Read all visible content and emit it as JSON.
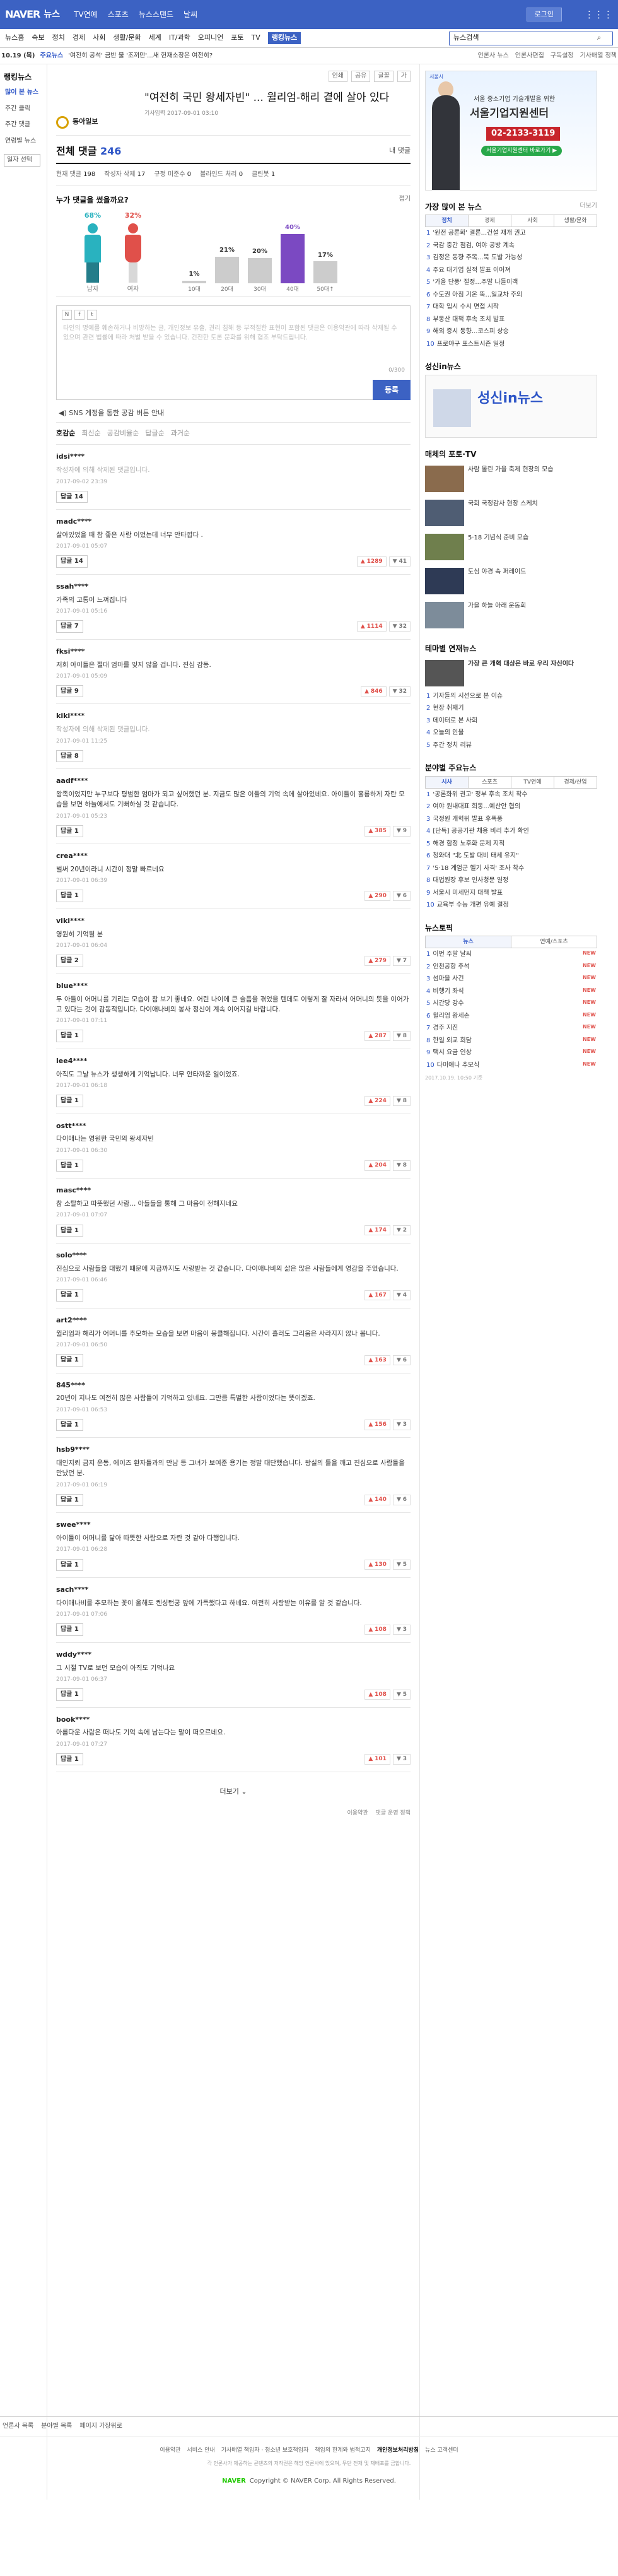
{
  "gnb": {
    "logo": "NAVER",
    "service": "뉴스",
    "tabs": [
      "TV연예",
      "스포츠",
      "뉴스스탠드",
      "날씨"
    ],
    "login": "로그인",
    "grid_icon": "grid-icon"
  },
  "lnb": {
    "items": [
      "뉴스홈",
      "속보",
      "정치",
      "경제",
      "사회",
      "생활/문화",
      "세계",
      "IT/과학",
      "오피니언",
      "포토",
      "TV",
      "랭킹뉴스"
    ],
    "active": 11,
    "search_placeholder": "뉴스검색"
  },
  "ticker": {
    "date": "10.19 (목)",
    "label": "주요뉴스",
    "headline": "'여전히 공석' 금반 불 '조끼만'...새 헌재소장은 여전히?",
    "right": [
      "언론사 뉴스",
      "언론사편집",
      "구독설정",
      "기사배열 정책"
    ]
  },
  "side": {
    "title": "랭킹뉴스",
    "items": [
      "많이 본 뉴스",
      "주간 클릭",
      "주간 댓글",
      "연령별 뉴스"
    ],
    "active": 0,
    "filter": "일자 선택"
  },
  "article": {
    "tools": [
      "인쇄",
      "공유",
      "글꼴",
      "가"
    ],
    "press": "동아일보",
    "headline": "\"여전히 국민 왕세자빈\" ... 윌리엄-해리 곁에 살아 있다",
    "meta": "기사입력 2017-09-01 03:10"
  },
  "comments": {
    "title": "전체 댓글",
    "count": "246",
    "mine": "내 댓글",
    "stats": [
      {
        "k": "현재 댓글",
        "v": "198"
      },
      {
        "k": "작성자 삭제",
        "v": "17"
      },
      {
        "k": "규정 미준수",
        "v": "0"
      },
      {
        "k": "블라인드 처리",
        "v": "0"
      },
      {
        "k": "클린봇",
        "v": "1"
      }
    ],
    "who_title": "누가 댓글을 썼을까요?",
    "fold": "접기",
    "gender": [
      {
        "label": "남자",
        "pct": "68%",
        "color": "#29b2bf"
      },
      {
        "label": "여자",
        "pct": "32%",
        "color": "#e0504a"
      }
    ],
    "ages_chart_label": "연령별",
    "write_placeholder": "타인의 명예를 훼손하거나 비방하는 글, 개인정보 유출, 권리 침해 등 부적절한 표현이 포함된 댓글은 이용약관에 따라 삭제될 수 있으며 관련 법률에 따라 처벌 받을 수 있습니다. 건전한 토론 문화를 위해 협조 부탁드립니다.",
    "counter": "0/300",
    "submit": "등록",
    "sns_notice": "SNS 계정을 통한 공감 버튼 안내",
    "sort": [
      "호감순",
      "최신순",
      "공감비율순",
      "답글순",
      "과거순"
    ],
    "list": [
      {
        "nick": "idsi****",
        "text": "작성자에 의해 삭제된 댓글입니다.",
        "deleted": true,
        "date": "2017-09-02 23:39",
        "reply": "답글 14",
        "up": "",
        "down": ""
      },
      {
        "nick": "madc****",
        "text": "살아있었을 때 참 좋은 사람 이었는데 너무 안타깝다 .",
        "deleted": false,
        "date": "2017-09-01 05:07",
        "reply": "답글 14",
        "up": "1289",
        "down": "41"
      },
      {
        "nick": "ssah****",
        "text": "가족의 고통이 느껴집니다",
        "deleted": false,
        "date": "2017-09-01 05:16",
        "reply": "답글 7",
        "up": "1114",
        "down": "32"
      },
      {
        "nick": "fksi****",
        "text": "저희 아이들은 절대 엄마를 잊지 않을 겁니다. 진심 감동.",
        "deleted": false,
        "date": "2017-09-01 05:09",
        "reply": "답글 9",
        "up": "846",
        "down": "32"
      },
      {
        "nick": "kiki****",
        "text": "작성자에 의해 삭제된 댓글입니다.",
        "deleted": true,
        "date": "2017-09-01 11:25",
        "reply": "답글 8",
        "up": "",
        "down": ""
      },
      {
        "nick": "aadf****",
        "text": "왕족이었지만 누구보다 평범한 엄마가 되고 싶어했던 분. 지금도 많은 이들의 기억 속에 살아있네요. 아이들이 훌륭하게 자란 모습을 보면 하늘에서도 기뻐하실 것 같습니다.",
        "deleted": false,
        "date": "2017-09-01 05:23",
        "reply": "답글 1",
        "up": "385",
        "down": "9"
      },
      {
        "nick": "crea****",
        "text": "벌써 20년이라니 시간이 정말 빠르네요",
        "deleted": false,
        "date": "2017-09-01 06:39",
        "reply": "답글 1",
        "up": "290",
        "down": "6"
      },
      {
        "nick": "viki****",
        "text": "영원히 기억될 분",
        "deleted": false,
        "date": "2017-09-01 06:04",
        "reply": "답글 2",
        "up": "279",
        "down": "7"
      },
      {
        "nick": "blue****",
        "text": "두 아들이 어머니를 기리는 모습이 참 보기 좋네요. 어린 나이에 큰 슬픔을 겪었을 텐데도 이렇게 잘 자라서 어머니의 뜻을 이어가고 있다는 것이 감동적입니다. 다이애나비의 봉사 정신이 계속 이어지길 바랍니다.",
        "deleted": false,
        "date": "2017-09-01 07:11",
        "reply": "답글 1",
        "up": "287",
        "down": "8"
      },
      {
        "nick": "lee4****",
        "text": "아직도 그날 뉴스가 생생하게 기억납니다. 너무 안타까운 일이었죠.",
        "deleted": false,
        "date": "2017-09-01 06:18",
        "reply": "답글 1",
        "up": "224",
        "down": "8"
      },
      {
        "nick": "ostt****",
        "text": "다이애나는 영원한 국민의 왕세자빈",
        "deleted": false,
        "date": "2017-09-01 06:30",
        "reply": "답글 1",
        "up": "204",
        "down": "8"
      },
      {
        "nick": "masc****",
        "text": "참 소탈하고 따뜻했던 사람... 아들들을 통해 그 마음이 전해지네요",
        "deleted": false,
        "date": "2017-09-01 07:07",
        "reply": "답글 1",
        "up": "174",
        "down": "2"
      },
      {
        "nick": "solo****",
        "text": "진심으로 사람들을 대했기 때문에 지금까지도 사랑받는 것 같습니다. 다이애나비의 삶은 많은 사람들에게 영감을 주었습니다.",
        "deleted": false,
        "date": "2017-09-01 06:46",
        "reply": "답글 1",
        "up": "167",
        "down": "4"
      },
      {
        "nick": "art2****",
        "text": "윌리엄과 해리가 어머니를 추모하는 모습을 보면 마음이 뭉클해집니다. 시간이 흘러도 그리움은 사라지지 않나 봅니다.",
        "deleted": false,
        "date": "2017-09-01 06:50",
        "reply": "답글 1",
        "up": "163",
        "down": "6"
      },
      {
        "nick": "845****",
        "text": "20년이 지나도 여전히 많은 사람들이 기억하고 있네요. 그만큼 특별한 사람이었다는 뜻이겠죠.",
        "deleted": false,
        "date": "2017-09-01 06:53",
        "reply": "답글 1",
        "up": "156",
        "down": "3"
      },
      {
        "nick": "hsb9****",
        "text": "대인지뢰 금지 운동, 에이즈 환자들과의 만남 등 그녀가 보여준 용기는 정말 대단했습니다. 왕실의 틀을 깨고 진심으로 사람들을 만났던 분.",
        "deleted": false,
        "date": "2017-09-01 06:19",
        "reply": "답글 1",
        "up": "140",
        "down": "6"
      },
      {
        "nick": "swee****",
        "text": "아이들이 어머니를 닮아 따뜻한 사람으로 자란 것 같아 다행입니다.",
        "deleted": false,
        "date": "2017-09-01 06:28",
        "reply": "답글 1",
        "up": "130",
        "down": "5"
      },
      {
        "nick": "sach****",
        "text": "다이애나비를 추모하는 꽃이 올해도 켄싱턴궁 앞에 가득했다고 하네요. 여전히 사랑받는 이유를 알 것 같습니다.",
        "deleted": false,
        "date": "2017-09-01 07:06",
        "reply": "답글 1",
        "up": "108",
        "down": "3"
      },
      {
        "nick": "wddy****",
        "text": "그 시절 TV로 보던 모습이 아직도 기억나요",
        "deleted": false,
        "date": "2017-09-01 06:37",
        "reply": "답글 1",
        "up": "108",
        "down": "5"
      },
      {
        "nick": "book****",
        "text": "아름다운 사람은 떠나도 기억 속에 남는다는 말이 떠오르네요.",
        "deleted": false,
        "date": "2017-09-01 07:27",
        "reply": "답글 1",
        "up": "101",
        "down": "3"
      }
    ],
    "more": "더보기",
    "foot": [
      "이용약관",
      "댓글 운영 정책"
    ]
  },
  "rail": {
    "ad1": {
      "brand": "서울시",
      "line1": "서울 중소기업 기술개발을 위한",
      "line2": "서울기업지원센터",
      "phone": "02-2133-3119",
      "cta": "서울기업지원센터 바로가기 ▶"
    },
    "most_viewed": {
      "title": "가장 많이 본 뉴스",
      "more": "더보기",
      "tabs": [
        "정치",
        "경제",
        "사회",
        "생활/문화"
      ],
      "items": [
        "'원전 공론화' 결론...건설 재개 권고",
        "국감 중간 점검, 여야 공방 계속",
        "김정은 동향 주목...북 도발 가능성",
        "주요 대기업 실적 발표 이어져",
        "'가을 단풍' 절정...주말 나들이객",
        "수도권 아침 기온 뚝...일교차 주의",
        "대학 입시 수시 면접 시작",
        "부동산 대책 후속 조치 발표",
        "해외 증시 동향...코스피 상승",
        "프로야구 포스트시즌 일정"
      ]
    },
    "ad2": {
      "title": "성신in뉴스",
      "logo": "성신in뉴스"
    },
    "photo": {
      "title": "매체의 포토·TV",
      "items": [
        {
          "cap": "사람 몰린 가을 축제 현장의 모습",
          "color": "#8a6b4d"
        },
        {
          "cap": "국회 국정감사 현장 스케치",
          "color": "#4f5d73"
        },
        {
          "cap": "5·18 기념식 준비 모습",
          "color": "#6f7f4d"
        },
        {
          "cap": "도심 야경 속 퍼레이드",
          "color": "#2e3a55"
        },
        {
          "cap": "가을 하늘 아래 운동회",
          "color": "#7d8c9a"
        }
      ]
    },
    "series": {
      "title": "테마별 연재뉴스",
      "lead": "가장 큰 개혁 대상은 바로 우리 자신이다",
      "lines": [
        "기자들의 시선으로 본 이슈",
        "현장 취재기",
        "데이터로 본 사회",
        "오늘의 인물",
        "주간 정치 리뷰"
      ]
    },
    "topic": {
      "title": "분야별 주요뉴스",
      "tabs": [
        "시사",
        "스포츠",
        "TV연예",
        "경제/산업"
      ],
      "items": [
        "'공론화위 권고' 정부 후속 조치 착수",
        "여야 원내대표 회동...예산안 협의",
        "국정원 개혁위 발표 후폭풍",
        "[단독] 공공기관 채용 비리 추가 확인",
        "해경 함정 노후화 문제 지적",
        "청와대 \"北 도발 대비 태세 유지\"",
        "'5·18 계엄군 헬기 사격' 조사 착수",
        "대법원장 후보 인사청문 일정",
        "서울시 미세먼지 대책 발표",
        "교육부 수능 개편 유예 결정"
      ]
    },
    "rank": {
      "title": "뉴스토픽",
      "tabs": [
        "뉴스",
        "연예/스포츠"
      ],
      "items": [
        "이번 주말 날씨",
        "인천공항 추석",
        "섬마을 사건",
        "비행기 좌석",
        "시간당 강수",
        "윌리엄 왕세손",
        "경주 지진",
        "한일 외교 회담",
        "택시 요금 인상",
        "다이애나 추모식"
      ],
      "time": "2017.10.19. 10:50 기준"
    }
  },
  "footer": {
    "links": [
      "언론사 목록",
      "분야별 목록",
      "페이지 가장위로"
    ],
    "policies": [
      "이용약관",
      "서비스 안내",
      "기사배열 책임자 · 청소년 보호책임자",
      "책임의 한계와 법적고지",
      "개인정보처리방침",
      "뉴스 고객센터"
    ],
    "notice": "각 언론사가 제공하는 콘텐츠의 저작권은 해당 언론사에 있으며, 무단 전재 및 재배포를 금합니다.",
    "brand": "NAVER",
    "copy": "Copyright © NAVER Corp. All Rights Reserved."
  }
}
